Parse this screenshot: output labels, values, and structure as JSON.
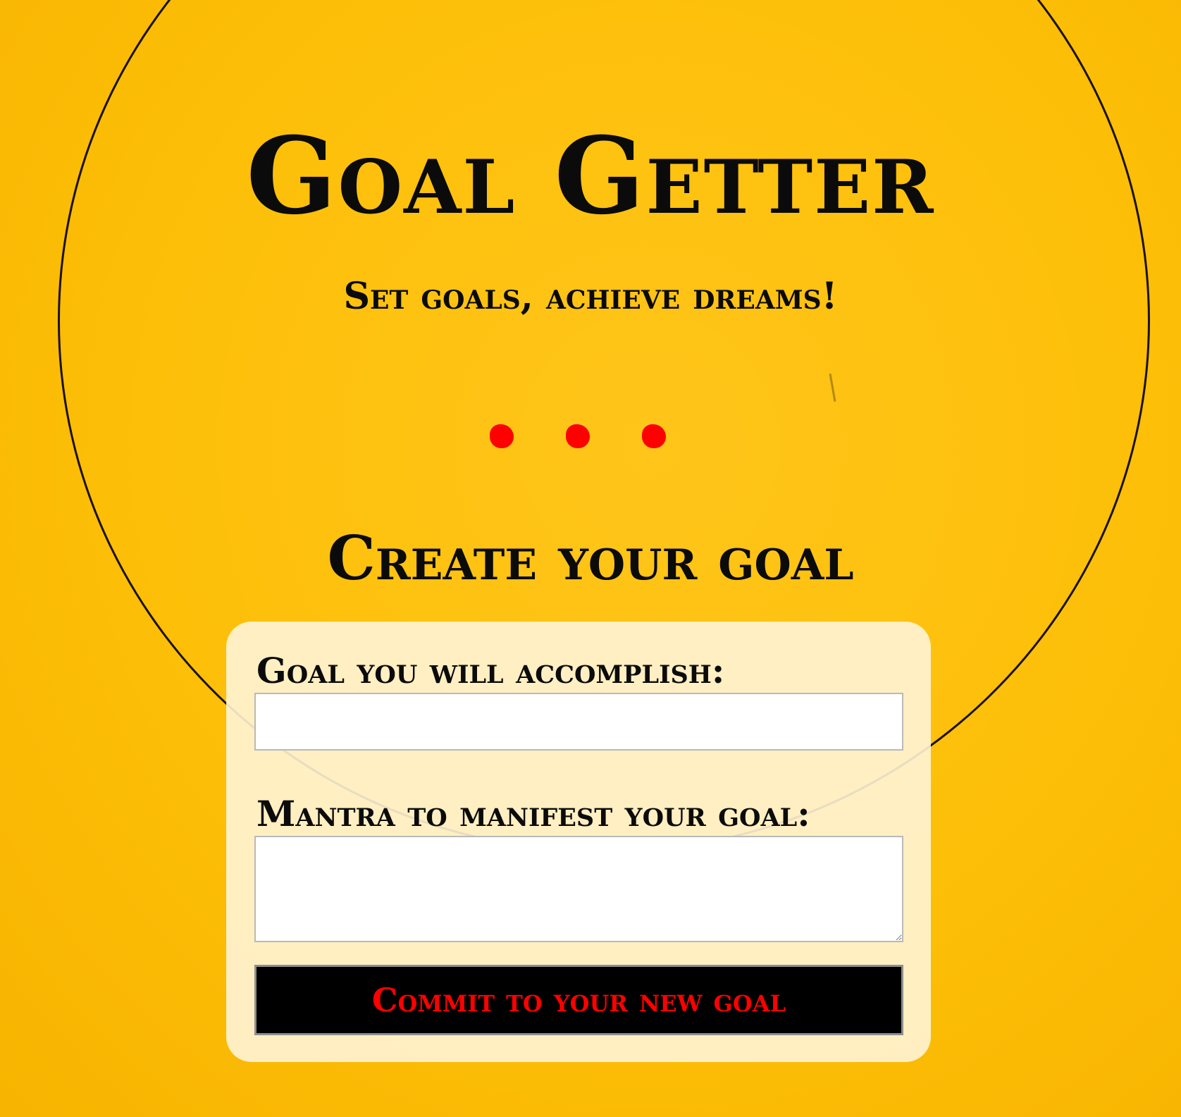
{
  "header": {
    "title": "Goal Getter",
    "subtitle": "Set goals, achieve dreams!"
  },
  "loading_indicator": {
    "dot_count": 3,
    "color": "#ff0000"
  },
  "form": {
    "heading": "Create your goal",
    "goal_label": "Goal you will accomplish:",
    "goal_value": "",
    "mantra_label": "Mantra to manifest your goal:",
    "mantra_value": "",
    "submit_label": "Commit to your new goal"
  },
  "colors": {
    "background": "#fdbf08",
    "card": "#fff4d6",
    "text": "#0b0b0b",
    "accent": "#ff0000",
    "button": "#000000"
  }
}
